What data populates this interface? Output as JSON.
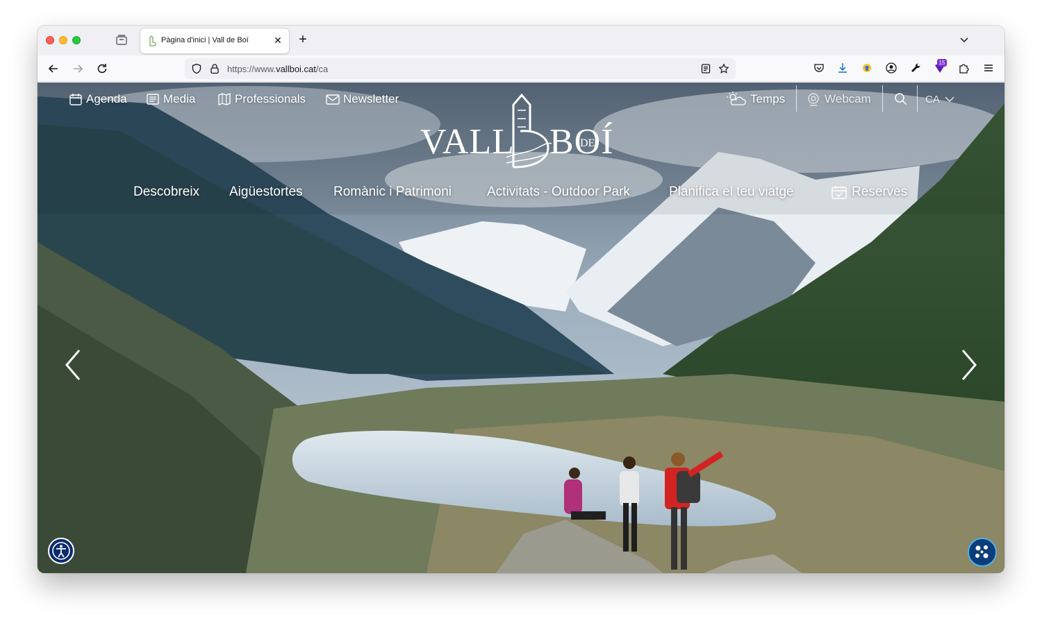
{
  "browser": {
    "tab": {
      "title": "Pàgina d'inici | Vall de Boí",
      "close_glyph": "✕"
    },
    "new_tab_glyph": "+",
    "url": {
      "scheme": "https://www.",
      "domain": "vallboi.cat",
      "path": "/ca"
    },
    "extensions_badge": "15",
    "icons": [
      "tabs-list-icon",
      "back-icon",
      "forward-icon",
      "reload-icon",
      "shield-icon",
      "lock-icon",
      "reader-view-icon",
      "bookmark-star-icon",
      "pocket-icon",
      "download-icon",
      "extension-icon",
      "account-icon",
      "wrench-icon",
      "extensions-badge-icon",
      "puzzle-icon",
      "menu-icon"
    ]
  },
  "site": {
    "top_nav": [
      {
        "label": "Agenda",
        "icon": "calendar-icon"
      },
      {
        "label": "Media",
        "icon": "newspaper-icon"
      },
      {
        "label": "Professionals",
        "icon": "map-book-icon"
      },
      {
        "label": "Newsletter",
        "icon": "envelope-icon"
      }
    ],
    "utility": {
      "weather": "Temps",
      "webcam": "Webcam",
      "language": "CA"
    },
    "logo": {
      "word1": "VALL",
      "de": "DE",
      "word2": "BOÍ"
    },
    "main_nav": [
      "Descobreix",
      "Aigüestortes",
      "Romànic i Patrimoni",
      "Activitats - Outdoor Park",
      "Planifica el teu viatge",
      "Reserves"
    ],
    "colors": {
      "accessibility_bg": "#0a2c6e",
      "chat_bg": "#0b3d7a",
      "chat_ring": "#4fb3e8"
    }
  }
}
